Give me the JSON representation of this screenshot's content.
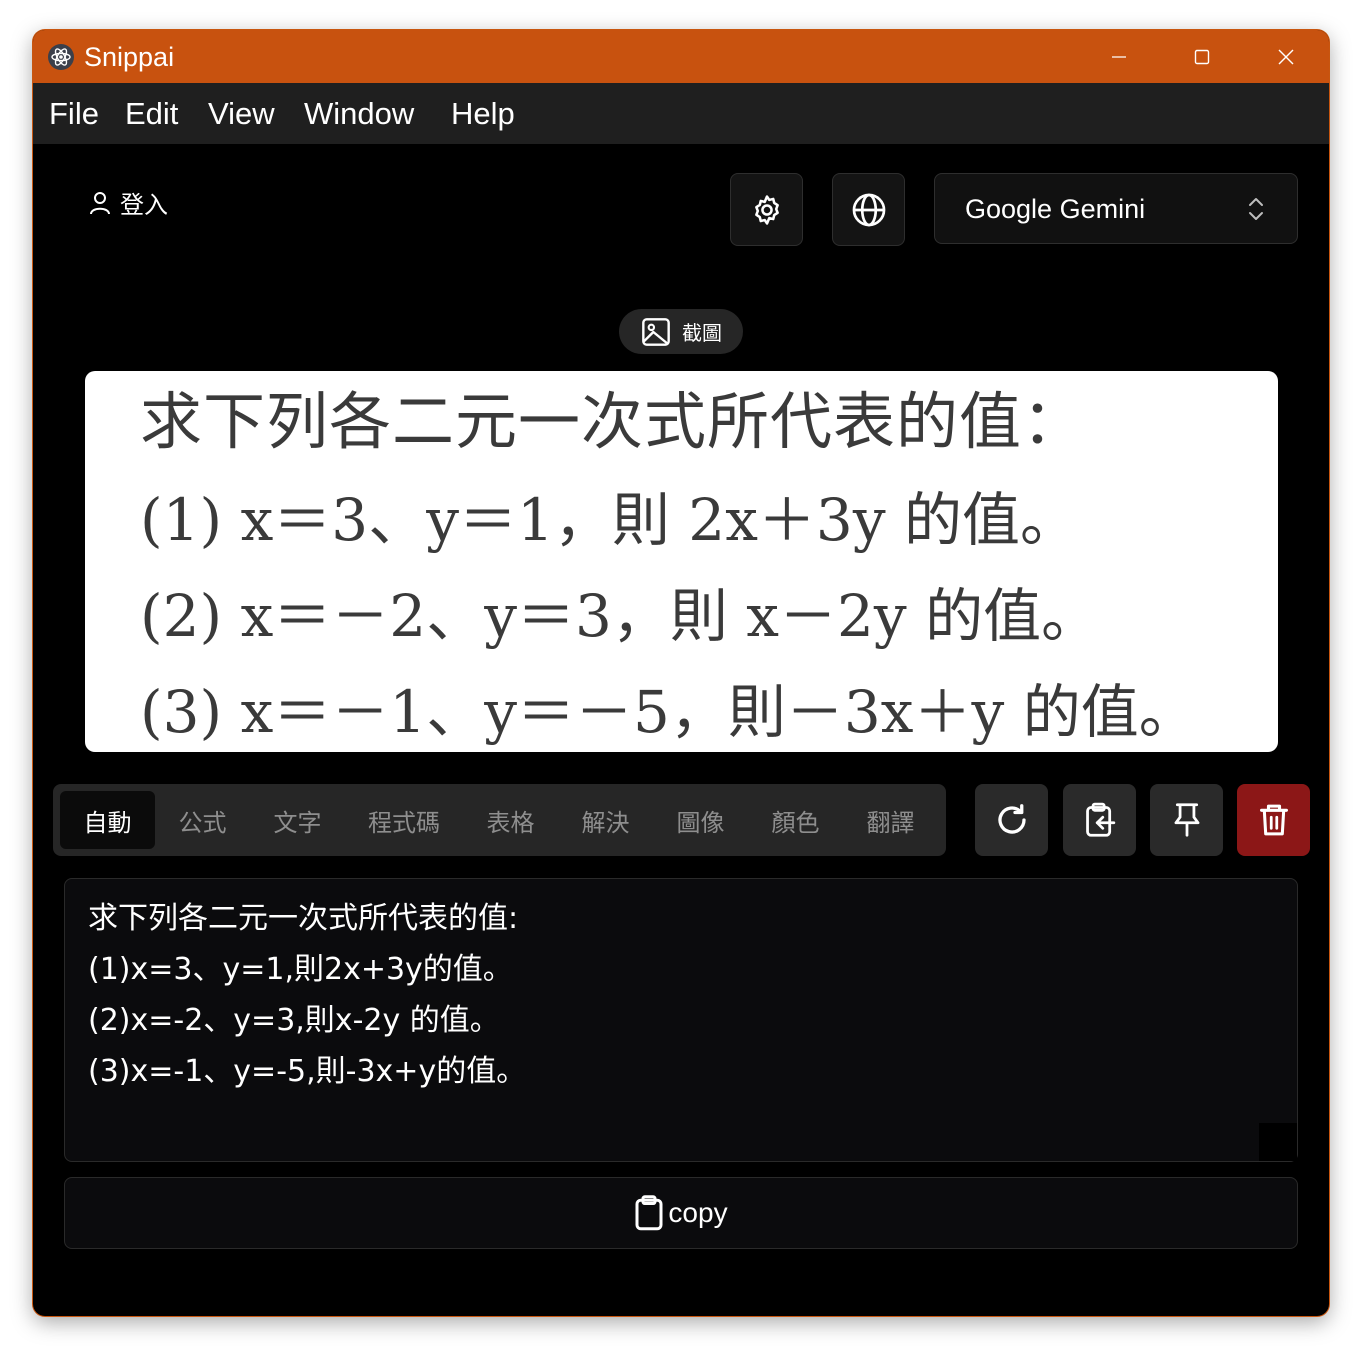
{
  "window": {
    "title": "Snippai",
    "accent": "#c8520f"
  },
  "menu": [
    "File",
    "Edit",
    "View",
    "Window",
    "Help"
  ],
  "header": {
    "login_label": "登入",
    "model": "Google Gemini"
  },
  "capture": {
    "label": "截圖"
  },
  "preview": {
    "lines": [
      "求下列各二元一次式所代表的值：",
      "(1)  x＝3、y＝1，則 2x＋3y 的值。",
      "(2)  x＝－2、y＝3，則 x－2y 的值。",
      "(3)  x＝－1、y＝－5，則－3x＋y 的值。"
    ]
  },
  "modes": {
    "active": "自動",
    "tabs": [
      "自動",
      "公式",
      "文字",
      "程式碼",
      "表格",
      "解決",
      "圖像",
      "顏色",
      "翻譯"
    ]
  },
  "actions": {
    "delete_color": "#8c1717",
    "icons": [
      "refresh-icon",
      "clipboard-import-icon",
      "pin-icon",
      "trash-icon"
    ]
  },
  "result": {
    "lines": [
      "求下列各二元一次式所代表的值:",
      "(1)x=3、y=1,則2x+3y的值。",
      "(2)x=-2、y=3,則x-2y 的值。",
      "(3)x=-1、y=-5,則-3x+y的值。"
    ]
  },
  "copy": {
    "label": "copy"
  }
}
